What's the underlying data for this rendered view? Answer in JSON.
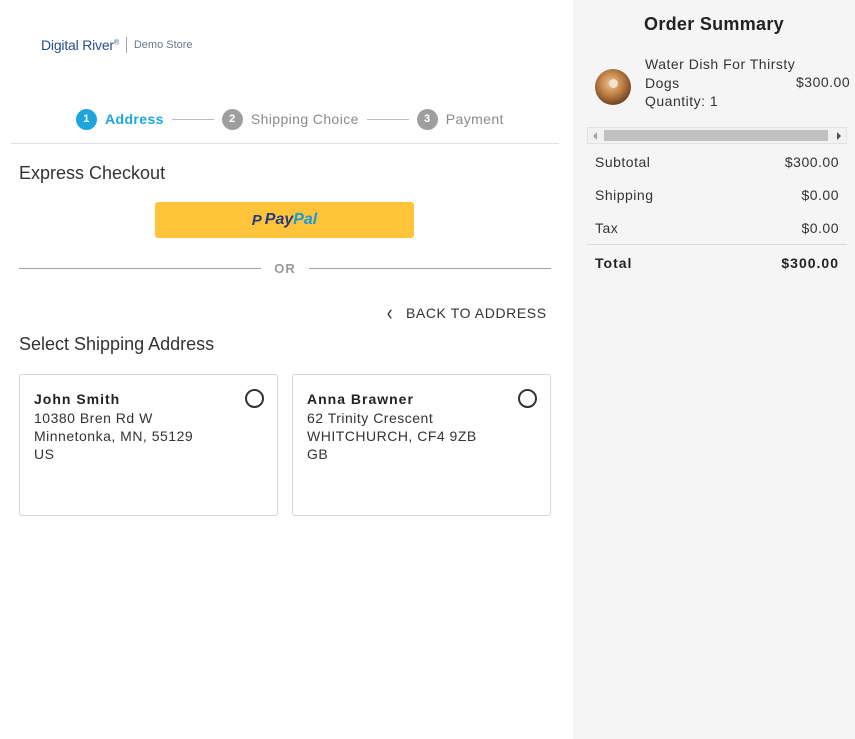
{
  "header": {
    "brand": "Digital River",
    "brand_mark": "®",
    "store": "Demo Store"
  },
  "stepper": [
    {
      "num": "1",
      "label": "Address",
      "state": "active"
    },
    {
      "num": "2",
      "label": "Shipping Choice",
      "state": "inactive"
    },
    {
      "num": "3",
      "label": "Payment",
      "state": "inactive"
    }
  ],
  "express": {
    "title": "Express Checkout",
    "paypal_mark": "P",
    "paypal_pay": "Pay",
    "paypal_pal": "Pal",
    "or_text": "OR"
  },
  "back_link": {
    "icon": "chevron-left-icon",
    "label": "BACK TO ADDRESS"
  },
  "shipping": {
    "title": "Select Shipping Address",
    "addresses": [
      {
        "name": "John Smith",
        "line1": "10380 Bren Rd W",
        "line2": "Minnetonka, MN, 55129",
        "line3": "US",
        "selected": false
      },
      {
        "name": "Anna Brawner",
        "line1": "62 Trinity Crescent",
        "line2": "WHITCHURCH, CF4 9ZB",
        "line3": "GB",
        "selected": false
      }
    ]
  },
  "order_summary": {
    "title": "Order Summary",
    "item": {
      "name": "Water Dish For Thirsty Dogs",
      "quantity": "Quantity: 1",
      "price": "$300.00"
    },
    "rows": [
      {
        "label": "Subtotal",
        "value": "$300.00"
      },
      {
        "label": "Shipping",
        "value": "$0.00"
      },
      {
        "label": "Tax",
        "value": "$0.00"
      }
    ],
    "total": {
      "label": "Total",
      "value": "$300.00"
    }
  },
  "colors": {
    "accent": "#1ca6dd",
    "paypal_yellow": "#ffc439",
    "brand_blue": "#2a4e8e",
    "sidebar_bg": "#f5f5f5"
  }
}
